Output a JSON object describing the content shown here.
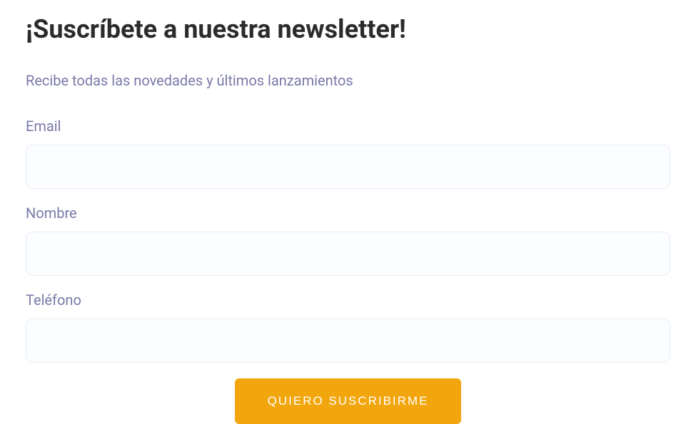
{
  "heading": "¡Suscríbete a nuestra newsletter!",
  "subtitle": "Recibe todas las novedades y últimos lanzamientos",
  "form": {
    "email": {
      "label": "Email",
      "value": ""
    },
    "name": {
      "label": "Nombre",
      "value": ""
    },
    "phone": {
      "label": "Teléfono",
      "value": ""
    },
    "submit_label": "QUIERO SUSCRIBIRME"
  }
}
